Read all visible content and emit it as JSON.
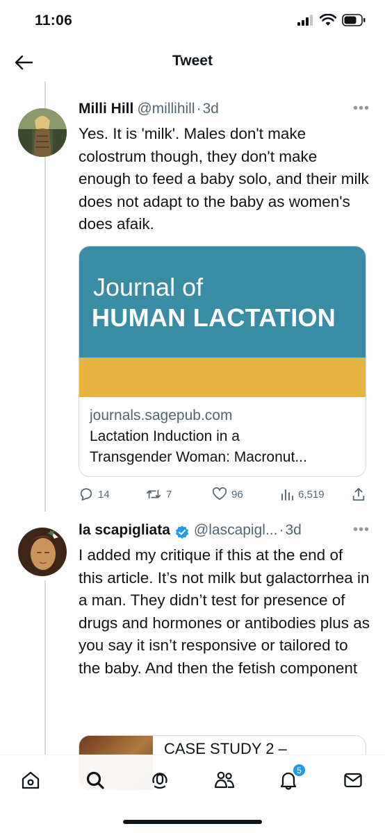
{
  "status": {
    "time": "11:06"
  },
  "header": {
    "title": "Tweet"
  },
  "tweet1": {
    "display_name": "Milli Hill",
    "handle": "@millihill",
    "separator": "·",
    "time": "3d",
    "text": "Yes. It is 'milk'. Males don't make colostrum though, they don't make enough to feed a baby solo, and their milk does not adapt to the baby as women's does afaik.",
    "card": {
      "image_line1": "Journal of",
      "image_line2": "HUMAN LACTATION",
      "domain": "journals.sagepub.com",
      "title_line1": "Lactation Induction in a",
      "title_line2": "Transgender Woman: Macronut..."
    },
    "actions": {
      "replies": "14",
      "retweets": "7",
      "likes": "96",
      "views": "6,519"
    }
  },
  "tweet2": {
    "display_name": "la scapigliata",
    "handle": "@lascapigl...",
    "separator": "·",
    "time": "3d",
    "text": "I added my critique if this at the end of this article. It’s not milk but galactorrhea in a man. They didn’t test for presence of drugs and hormones or antibodies plus as you say it isn’t responsive or tailored to the baby. And then the fetish component",
    "card_title": "CASE STUDY 2 –"
  },
  "tabbar": {
    "notifications_badge": "5"
  },
  "colors": {
    "accent": "#1d9bf0",
    "journal_blue": "#3a8ba4",
    "journal_yellow": "#e9b341"
  },
  "icons": [
    "back-arrow-icon",
    "home-icon",
    "search-icon",
    "spaces-icon",
    "communities-icon",
    "notifications-bell-icon",
    "messages-icon",
    "reply-icon",
    "retweet-icon",
    "like-icon",
    "views-icon",
    "share-icon",
    "verified-badge-icon"
  ]
}
